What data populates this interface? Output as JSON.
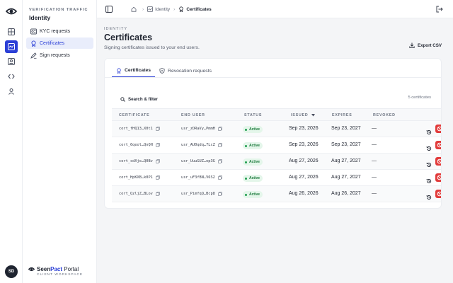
{
  "sidebar": {
    "kicker": "VERIFICATION TRAFFIC",
    "app_name": "Identity",
    "items": [
      {
        "label": "KYC requests",
        "icon": "kyc-icon"
      },
      {
        "label": "Certificates",
        "icon": "certificate-icon",
        "active": true
      },
      {
        "label": "Sign requests",
        "icon": "sign-icon"
      }
    ],
    "brand": {
      "name_a": "Seen",
      "name_b": "Pact",
      "name_c": " Portal",
      "subtitle": "CLIENT WORKSPACE"
    },
    "avatar_initials": "SD"
  },
  "topbar": {
    "breadcrumbs": [
      {
        "label": "Identity"
      },
      {
        "label": "Certificates"
      }
    ]
  },
  "page": {
    "kicker": "IDENTITY",
    "title": "Certificates",
    "subtitle": "Signing certificates issued to your end users.",
    "export_label": "Export CSV"
  },
  "tabs": [
    {
      "label": "Certificates",
      "active": true
    },
    {
      "label": "Revocation requests"
    }
  ],
  "toolbar": {
    "search_label": "Search & filter",
    "count_label": "5 certificates"
  },
  "table": {
    "columns": [
      "CERTIFICATE",
      "END USER",
      "STATUS",
      "ISSUED",
      "EXPIRES",
      "REVOKED"
    ],
    "rows": [
      {
        "cert": "cert_fHQ13…X0t1",
        "user": "usr_zDRaVy…PmmH",
        "status": "Active",
        "issued": "Sep 23, 2026",
        "expires": "Sep 23, 2027",
        "revoked": "—"
      },
      {
        "cert": "cert_6qeol…QnQH",
        "user": "usr_AU0qdq…7LcZ",
        "status": "Active",
        "issued": "Sep 23, 2026",
        "expires": "Sep 23, 2027",
        "revoked": "—"
      },
      {
        "cert": "cert_sdXje…Q0Bv",
        "user": "usr_UuuGUZ…ep3G",
        "status": "Active",
        "issued": "Aug 27, 2026",
        "expires": "Aug 27, 2027",
        "revoked": "—"
      },
      {
        "cert": "cert_HpKXB…k0P1",
        "user": "usr_uF3fBN…V6S2",
        "status": "Active",
        "issued": "Aug 27, 2026",
        "expires": "Aug 27, 2027",
        "revoked": "—"
      },
      {
        "cert": "cert_QzljZ…BLov",
        "user": "usr_PimfqQ…Bcp8",
        "status": "Active",
        "issued": "Aug 26, 2026",
        "expires": "Aug 26, 2027",
        "revoked": "—"
      }
    ]
  },
  "colors": {
    "accent": "#2b3fd6",
    "danger": "#e23b3b",
    "active_badge_bg": "#e4f6ea",
    "active_badge_text": "#1d7a3d"
  }
}
